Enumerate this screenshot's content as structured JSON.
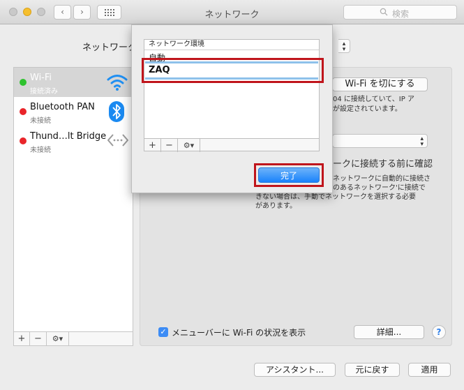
{
  "window": {
    "title": "ネットワーク",
    "back": "‹",
    "forward": "›",
    "search_placeholder": "検索"
  },
  "env_label": "ネットワーク",
  "services": [
    {
      "name": "Wi-Fi",
      "status": "接続済み",
      "color": "#2ec22e",
      "icon": "wifi-icon"
    },
    {
      "name": "Bluetooth PAN",
      "status": "未接続",
      "color": "#e9252a",
      "icon": "bluetooth-icon"
    },
    {
      "name": "Thund…lt Bridge",
      "status": "未接続",
      "color": "#e9252a",
      "icon": "thunderbolt-bridge-icon"
    }
  ],
  "sidebar_toolbar": {
    "add": "+",
    "remove": "−",
    "action": "⚙▾"
  },
  "panel": {
    "wifi_off_button": "Wi-Fi を切にする",
    "status_line1": "04 に接続していて、IP ア",
    "status_line2": "が設定されています。",
    "ask_label": "ークに接続する前に確認",
    "ask_desc1": "ネットワークに自動的に接続さ",
    "ask_desc2": "のあるネットワーク'に接続で",
    "ask_desc3": "きない場合は、手動でネットワークを選択する必要",
    "ask_desc4": "があります。",
    "menubar_checkbox_label": "メニューバーに Wi-Fi の状況を表示",
    "menubar_checked": true,
    "advanced_button": "詳細...",
    "help": "?"
  },
  "footer": {
    "assistant": "アシスタント...",
    "revert": "元に戻す",
    "apply": "適用"
  },
  "sheet": {
    "list_header": "ネットワーク環境",
    "locations": [
      "自動",
      "ZAQ"
    ],
    "selected": "ZAQ",
    "toolbar": {
      "add": "+",
      "remove": "−",
      "action": "⚙▾"
    },
    "done_button": "完了",
    "highlight_color": "#c0151c"
  }
}
